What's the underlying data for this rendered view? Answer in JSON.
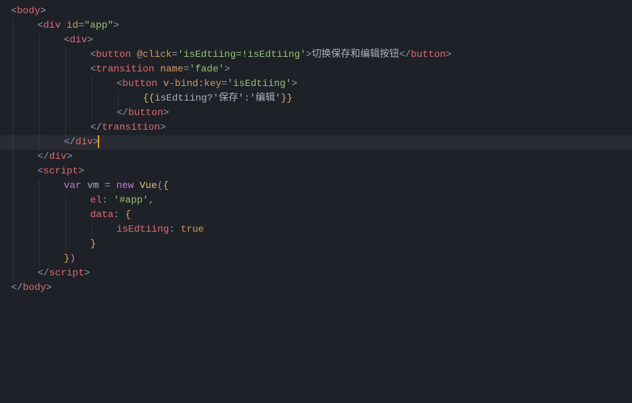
{
  "lines": [
    {
      "indent": 0,
      "segments": [
        {
          "t": "<",
          "c": "punct"
        },
        {
          "t": "body",
          "c": "tag"
        },
        {
          "t": ">",
          "c": "punct"
        }
      ]
    },
    {
      "indent": 1,
      "segments": [
        {
          "t": "<",
          "c": "punct"
        },
        {
          "t": "div",
          "c": "tag"
        },
        {
          "t": " ",
          "c": "text"
        },
        {
          "t": "id",
          "c": "attr"
        },
        {
          "t": "=",
          "c": "eq"
        },
        {
          "t": "\"app\"",
          "c": "str"
        },
        {
          "t": ">",
          "c": "punct"
        }
      ]
    },
    {
      "indent": 2,
      "segments": [
        {
          "t": "<",
          "c": "punct"
        },
        {
          "t": "div",
          "c": "tag"
        },
        {
          "t": ">",
          "c": "punct"
        }
      ]
    },
    {
      "indent": 3,
      "segments": [
        {
          "t": "<",
          "c": "punct"
        },
        {
          "t": "button",
          "c": "tag"
        },
        {
          "t": " ",
          "c": "text"
        },
        {
          "t": "@click",
          "c": "attr"
        },
        {
          "t": "=",
          "c": "eq"
        },
        {
          "t": "'isEdtiing=!isEdtiing'",
          "c": "str"
        },
        {
          "t": ">",
          "c": "punct"
        },
        {
          "t": "切换保存和编辑按钮",
          "c": "text"
        },
        {
          "t": "</",
          "c": "punct"
        },
        {
          "t": "button",
          "c": "tag"
        },
        {
          "t": ">",
          "c": "punct"
        }
      ]
    },
    {
      "indent": 3,
      "segments": [
        {
          "t": "<",
          "c": "punct"
        },
        {
          "t": "transition",
          "c": "tag"
        },
        {
          "t": " ",
          "c": "text"
        },
        {
          "t": "name",
          "c": "attr"
        },
        {
          "t": "=",
          "c": "eq"
        },
        {
          "t": "'fade'",
          "c": "str"
        },
        {
          "t": ">",
          "c": "punct"
        }
      ]
    },
    {
      "indent": 4,
      "segments": [
        {
          "t": "<",
          "c": "punct"
        },
        {
          "t": "button",
          "c": "tag"
        },
        {
          "t": " ",
          "c": "text"
        },
        {
          "t": "v-bind:key",
          "c": "attr"
        },
        {
          "t": "=",
          "c": "eq"
        },
        {
          "t": "'isEdtiing'",
          "c": "str"
        },
        {
          "t": ">",
          "c": "punct"
        }
      ]
    },
    {
      "indent": 5,
      "segments": [
        {
          "t": "{{",
          "c": "brace"
        },
        {
          "t": "isEdtiing?'保存':'编辑'",
          "c": "text"
        },
        {
          "t": "}}",
          "c": "brace"
        }
      ]
    },
    {
      "indent": 4,
      "segments": [
        {
          "t": "</",
          "c": "punct"
        },
        {
          "t": "button",
          "c": "tag"
        },
        {
          "t": ">",
          "c": "punct"
        }
      ]
    },
    {
      "indent": 3,
      "segments": [
        {
          "t": "</",
          "c": "punct"
        },
        {
          "t": "transition",
          "c": "tag"
        },
        {
          "t": ">",
          "c": "punct"
        }
      ]
    },
    {
      "indent": 2,
      "highlight": true,
      "cursorAfter": true,
      "segments": [
        {
          "t": "</",
          "c": "punct"
        },
        {
          "t": "div",
          "c": "tag"
        },
        {
          "t": ">",
          "c": "punct"
        }
      ]
    },
    {
      "indent": 1,
      "segments": [
        {
          "t": "</",
          "c": "punct"
        },
        {
          "t": "div",
          "c": "tag"
        },
        {
          "t": ">",
          "c": "punct"
        }
      ]
    },
    {
      "indent": 1,
      "segments": [
        {
          "t": "<",
          "c": "punct"
        },
        {
          "t": "script",
          "c": "tag"
        },
        {
          "t": ">",
          "c": "punct"
        }
      ]
    },
    {
      "indent": 2,
      "segments": [
        {
          "t": "var",
          "c": "kw"
        },
        {
          "t": " ",
          "c": "text"
        },
        {
          "t": "vm",
          "c": "ident2"
        },
        {
          "t": " ",
          "c": "text"
        },
        {
          "t": "=",
          "c": "punct"
        },
        {
          "t": " ",
          "c": "text"
        },
        {
          "t": "new",
          "c": "kw2"
        },
        {
          "t": " ",
          "c": "text"
        },
        {
          "t": "Vue",
          "c": "class"
        },
        {
          "t": "(",
          "c": "paren"
        },
        {
          "t": "{",
          "c": "brace"
        }
      ]
    },
    {
      "indent": 3,
      "segments": [
        {
          "t": "el",
          "c": "prop"
        },
        {
          "t": ": ",
          "c": "punct"
        },
        {
          "t": "'#app'",
          "c": "str"
        },
        {
          "t": ",",
          "c": "punct"
        }
      ]
    },
    {
      "indent": 3,
      "segments": [
        {
          "t": "data",
          "c": "prop"
        },
        {
          "t": ": ",
          "c": "punct"
        },
        {
          "t": "{",
          "c": "brace"
        }
      ]
    },
    {
      "indent": 4,
      "segments": [
        {
          "t": "isEdtiing",
          "c": "prop"
        },
        {
          "t": ": ",
          "c": "punct"
        },
        {
          "t": "true",
          "c": "bool"
        }
      ]
    },
    {
      "indent": 3,
      "segments": [
        {
          "t": "}",
          "c": "brace"
        }
      ]
    },
    {
      "indent": 2,
      "segments": [
        {
          "t": "}",
          "c": "brace"
        },
        {
          "t": ")",
          "c": "paren"
        }
      ]
    },
    {
      "indent": 1,
      "segments": [
        {
          "t": "</",
          "c": "punct"
        },
        {
          "t": "script",
          "c": "tag"
        },
        {
          "t": ">",
          "c": "punct"
        }
      ]
    },
    {
      "indent": 0,
      "segments": [
        {
          "t": "</",
          "c": "punct"
        },
        {
          "t": "body",
          "c": "tag"
        },
        {
          "t": ">",
          "c": "punct"
        }
      ]
    }
  ],
  "indentUnit": 38,
  "leftPad": 18
}
